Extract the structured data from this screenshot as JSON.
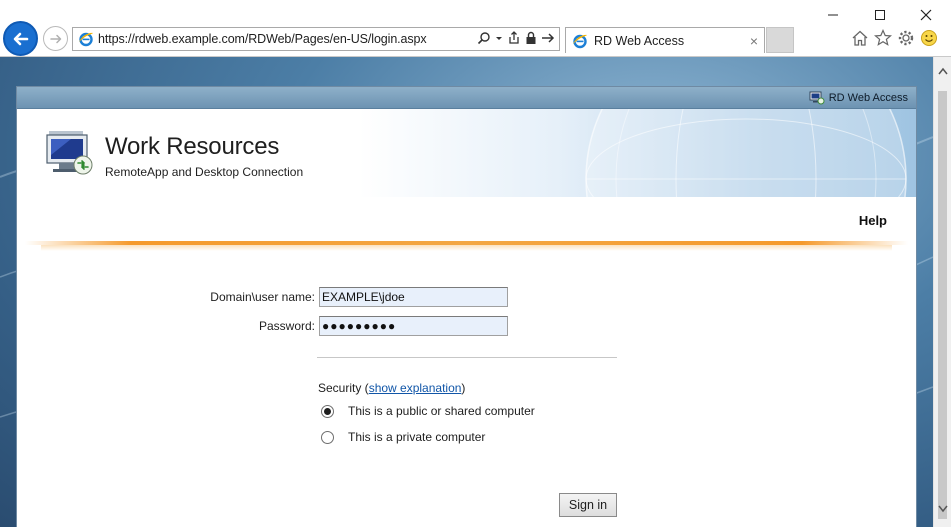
{
  "browser": {
    "url": "https://rdweb.example.com/RDWeb/Pages/en-US/login.aspx",
    "tab_title": "RD Web Access",
    "tab_close": "×",
    "window_controls": [
      "minimize-icon",
      "maximize-icon",
      "close-icon"
    ],
    "toolbar_icons": [
      "home-icon",
      "favorites-star-icon",
      "settings-gear-icon",
      "feedback-smiley-icon"
    ],
    "address_icons": [
      "search-icon",
      "dropdown-icon",
      "compatibility-icon",
      "lock-icon",
      "go-arrow-icon"
    ]
  },
  "page": {
    "topbar_label": "RD Web Access",
    "title": "Work Resources",
    "subtitle": "RemoteApp and Desktop Connection",
    "help": "Help"
  },
  "form": {
    "username_label": "Domain\\user name:",
    "username_value": "EXAMPLE\\jdoe",
    "password_label": "Password:",
    "password_mask": "●●●●●●●●●",
    "security_prefix": "Security (",
    "security_link": "show explanation",
    "security_suffix": ")",
    "radio_options": [
      {
        "label": "This is a public or shared computer",
        "selected": true
      },
      {
        "label": "This is a private computer",
        "selected": false
      }
    ],
    "signin_label": "Sign in"
  },
  "colors": {
    "accent_orange": "#f59a2c",
    "link_blue": "#1156a8",
    "topbar_blue": "#7fa3c0",
    "input_bg": "#e8f0fb"
  }
}
